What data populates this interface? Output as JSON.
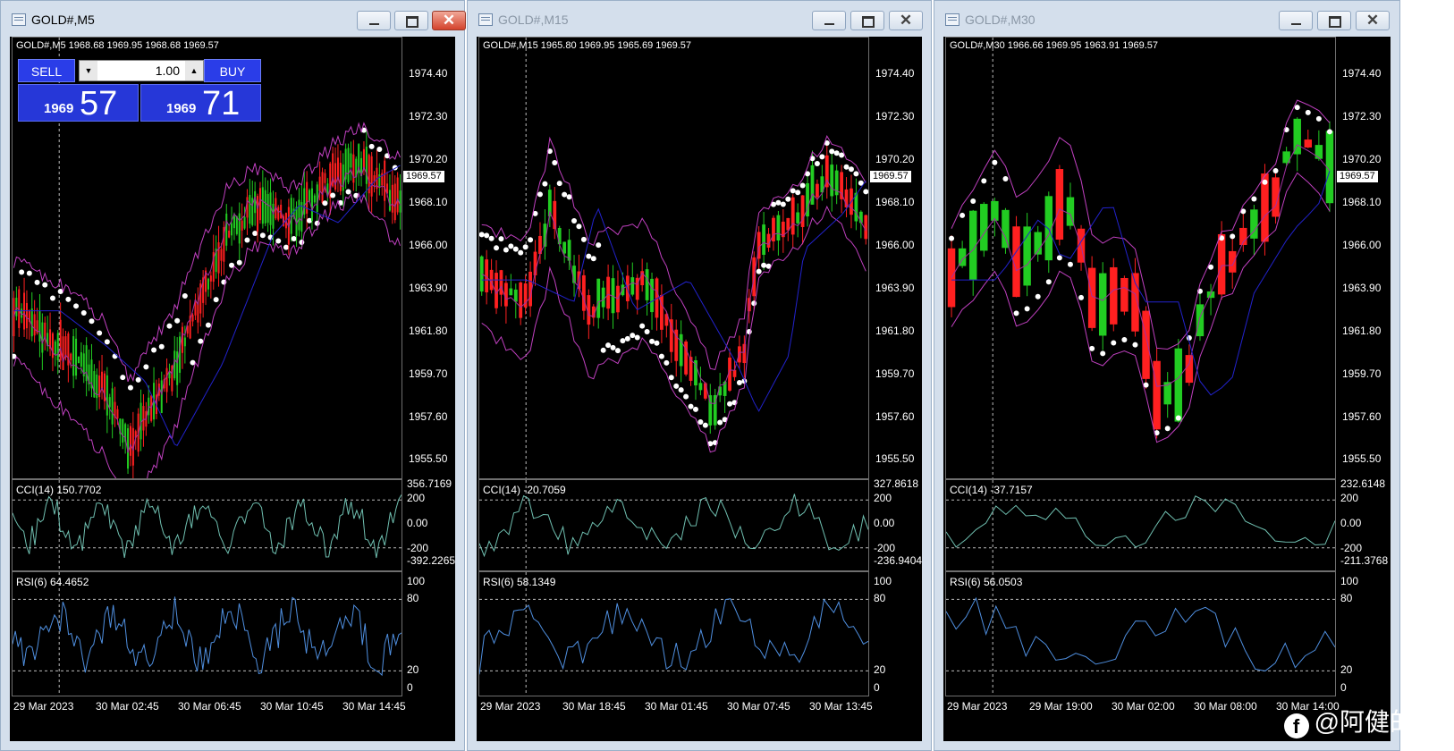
{
  "windows": [
    {
      "title": "GOLD#,M5",
      "active": true,
      "header": "GOLD#,M5  1968.68 1969.95 1968.68 1969.57",
      "current_price": "1969.57",
      "price_levels": [
        "1974.40",
        "1972.30",
        "1970.20",
        "1968.10",
        "1966.00",
        "1963.90",
        "1961.80",
        "1959.70",
        "1957.60",
        "1955.50"
      ],
      "price_range": [
        1954.6,
        1976.2
      ],
      "cci_label": "CCI(14) 150.7702",
      "cci_levels": [
        "356.7169",
        "200",
        "0.00",
        "-200",
        "-392.2265"
      ],
      "rsi_label": "RSI(6) 64.4652",
      "rsi_levels": [
        "100",
        "80",
        "20",
        "0"
      ],
      "time_labels": [
        "29 Mar 2023",
        "30 Mar 02:45",
        "30 Mar 06:45",
        "30 Mar 10:45",
        "30 Mar 14:45"
      ],
      "trade_panel": {
        "sell_label": "SELL",
        "buy_label": "BUY",
        "lot": "1.00",
        "sell_small": "1969",
        "sell_big": "57",
        "buy_small": "1969",
        "buy_big": "71"
      },
      "colors": {
        "bull": "#22cc22",
        "bear": "#ff2020"
      }
    },
    {
      "title": "GOLD#,M15",
      "active": false,
      "header": "GOLD#,M15  1965.80 1969.95 1965.69 1969.57",
      "current_price": "1969.57",
      "price_levels": [
        "1974.40",
        "1972.30",
        "1970.20",
        "1968.10",
        "1966.00",
        "1963.90",
        "1961.80",
        "1959.70",
        "1957.60",
        "1955.50"
      ],
      "price_range": [
        1954.6,
        1976.2
      ],
      "cci_label": "CCI(14) -20.7059",
      "cci_levels": [
        "327.8618",
        "200",
        "0.00",
        "-200",
        "-236.9404"
      ],
      "rsi_label": "RSI(6) 58.1349",
      "rsi_levels": [
        "100",
        "80",
        "20",
        "0"
      ],
      "time_labels": [
        "29 Mar 2023",
        "30 Mar 18:45",
        "30 Mar 01:45",
        "30 Mar 07:45",
        "30 Mar 13:45"
      ],
      "colors": {
        "bull": "#22cc22",
        "bear": "#ff2020"
      }
    },
    {
      "title": "GOLD#,M30",
      "active": false,
      "header": "GOLD#,M30  1966.66 1969.95 1963.91 1969.57",
      "current_price": "1969.57",
      "price_levels": [
        "1974.40",
        "1972.30",
        "1970.20",
        "1968.10",
        "1966.00",
        "1963.90",
        "1961.80",
        "1959.70",
        "1957.60",
        "1955.50"
      ],
      "price_range": [
        1954.6,
        1976.2
      ],
      "cci_label": "CCI(14) -37.7157",
      "cci_levels": [
        "232.6148",
        "200",
        "0.00",
        "-200",
        "-211.3768"
      ],
      "rsi_label": "RSI(6) 56.0503",
      "rsi_levels": [
        "100",
        "80",
        "20",
        "0"
      ],
      "time_labels": [
        "29 Mar 2023",
        "29 Mar 19:00",
        "30 Mar 02:00",
        "30 Mar 08:00",
        "30 Mar 14:00"
      ],
      "colors": {
        "bull": "#22cc22",
        "bear": "#ff2020"
      }
    }
  ],
  "watermark": "@阿健的健",
  "watermark_icon": "facebook-icon"
}
